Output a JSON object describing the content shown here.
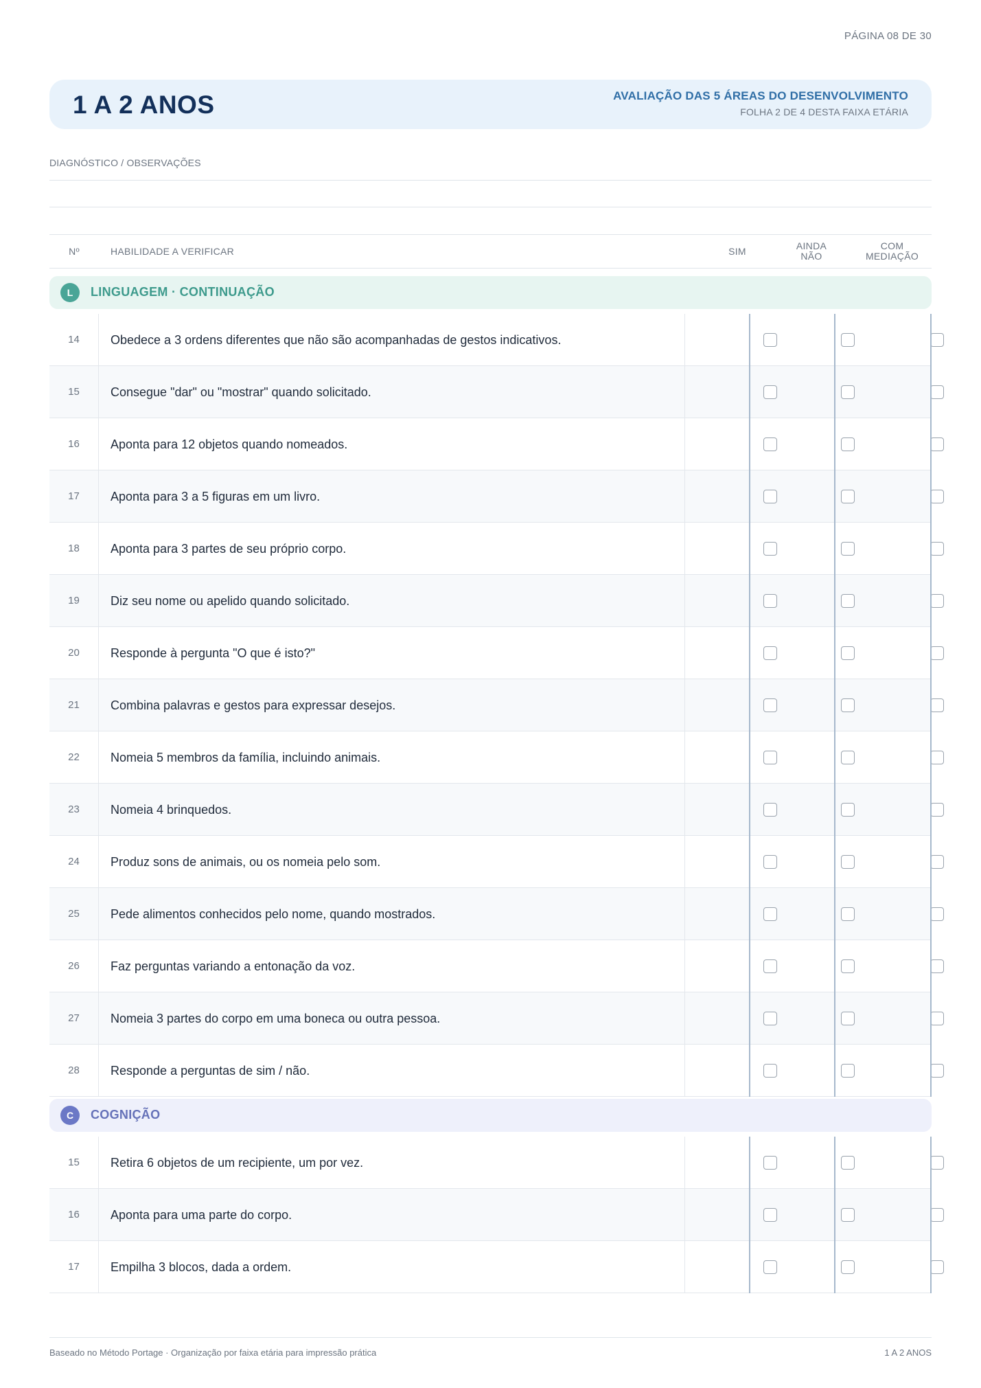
{
  "page_number": "PÁGINA 08 DE 30",
  "banner": {
    "title": "1 A 2 ANOS",
    "subtitle": "AVALIAÇÃO DAS 5 ÁREAS DO DESENVOLVIMENTO",
    "sheet": "FOLHA 2 DE 4 DESTA FAIXA ETÁRIA"
  },
  "observations_label": "DIAGNÓSTICO / OBSERVAÇÕES",
  "table_header": {
    "num": "Nº",
    "skill": "HABILIDADE A VERIFICAR",
    "yes": "SIM",
    "not_yet_line1": "AINDA",
    "not_yet_line2": "NÃO",
    "mediation_line1": "COM",
    "mediation_line2": "MEDIAÇÃO"
  },
  "sections": [
    {
      "badge": "L",
      "title": "LINGUAGEM · CONTINUAÇÃO",
      "items": [
        {
          "num": "14",
          "text": "Obedece a 3 ordens diferentes que não são acompanhadas de gestos indicativos."
        },
        {
          "num": "15",
          "text": "Consegue \"dar\" ou \"mostrar\" quando solicitado."
        },
        {
          "num": "16",
          "text": "Aponta para 12 objetos quando nomeados."
        },
        {
          "num": "17",
          "text": "Aponta para 3 a 5 figuras em um livro."
        },
        {
          "num": "18",
          "text": "Aponta para 3 partes de seu próprio corpo."
        },
        {
          "num": "19",
          "text": "Diz seu nome ou apelido quando solicitado."
        },
        {
          "num": "20",
          "text": "Responde à pergunta \"O que é isto?\""
        },
        {
          "num": "21",
          "text": "Combina palavras e gestos para expressar desejos."
        },
        {
          "num": "22",
          "text": "Nomeia 5 membros da família, incluindo animais."
        },
        {
          "num": "23",
          "text": "Nomeia 4 brinquedos."
        },
        {
          "num": "24",
          "text": "Produz sons de animais, ou os nomeia pelo som."
        },
        {
          "num": "25",
          "text": "Pede alimentos conhecidos pelo nome, quando mostrados."
        },
        {
          "num": "26",
          "text": "Faz perguntas variando a entonação da voz."
        },
        {
          "num": "27",
          "text": "Nomeia 3 partes do corpo em uma boneca ou outra pessoa."
        },
        {
          "num": "28",
          "text": "Responde a perguntas de sim / não."
        }
      ]
    },
    {
      "badge": "C",
      "title": "COGNIÇÃO",
      "items": [
        {
          "num": "15",
          "text": "Retira 6 objetos de um recipiente, um por vez."
        },
        {
          "num": "16",
          "text": "Aponta para uma parte do corpo."
        },
        {
          "num": "17",
          "text": "Empilha 3 blocos, dada a ordem."
        }
      ]
    }
  ],
  "footer": {
    "left": "Baseado no Método Portage · Organização por faixa etária para impressão prática",
    "right": "1 A 2 ANOS"
  }
}
